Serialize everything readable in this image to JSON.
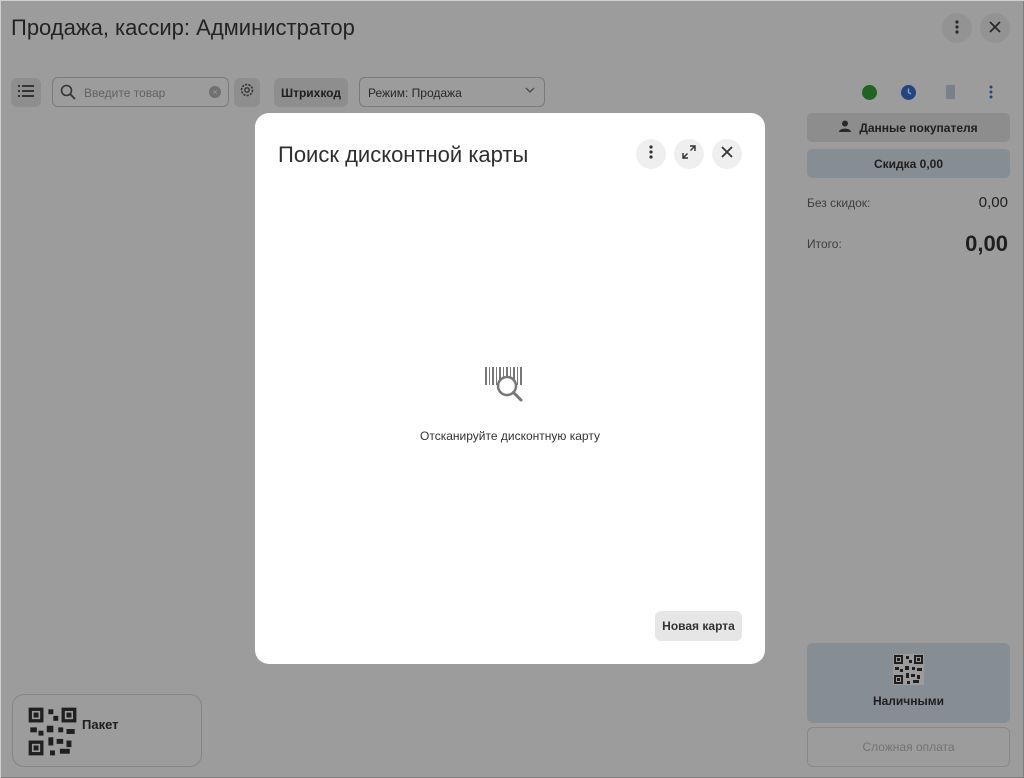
{
  "window": {
    "title": "Продажа, кассир: Администратор"
  },
  "toolbar": {
    "search_placeholder": "Введите товар",
    "barcode_label": "Штрихкод",
    "mode_label": "Режим: Продажа"
  },
  "status": {
    "online_color": "#35a435",
    "clock_color": "#3a72d6"
  },
  "right_panel": {
    "customer_label": "Данные покупателя",
    "discount_label": "Скидка 0,00",
    "without_discount_label": "Без скидок:",
    "without_discount_value": "0,00",
    "total_label": "Итого:",
    "total_value": "0,00",
    "cash_label": "Наличными",
    "complex_payment_label": "Сложная оплата"
  },
  "quick_items": [
    {
      "label": "Пакет"
    }
  ],
  "modal": {
    "title": "Поиск дисконтной карты",
    "scan_prompt": "Отсканируйте дисконтную карту",
    "new_card_label": "Новая карта"
  }
}
